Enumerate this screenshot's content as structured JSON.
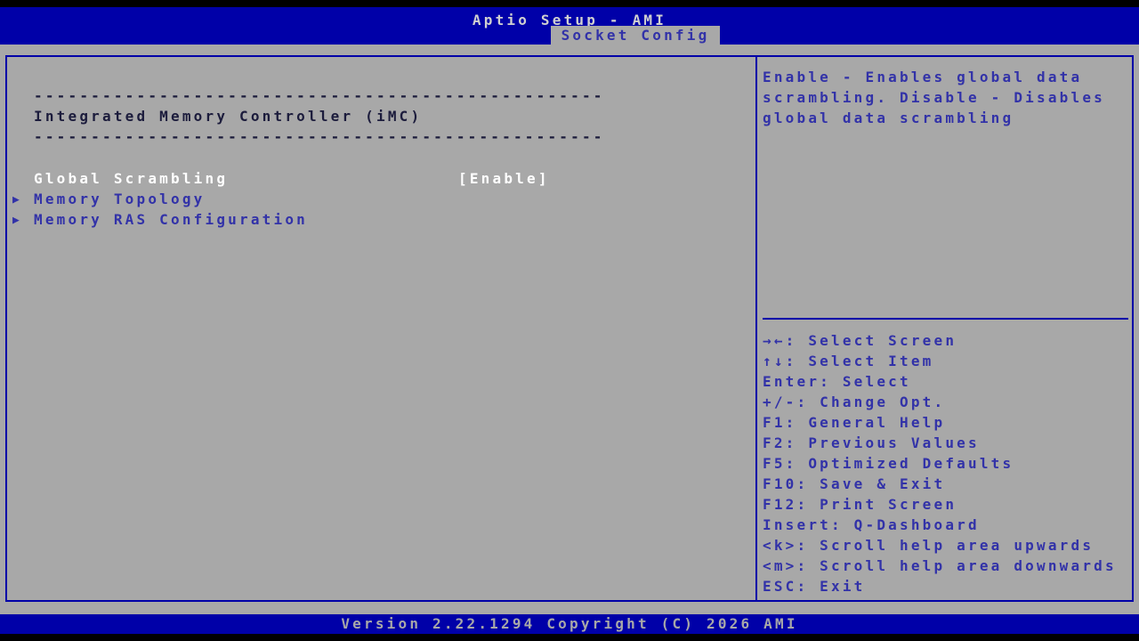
{
  "header": {
    "title": "Aptio Setup - AMI",
    "tab": "Socket Config"
  },
  "main": {
    "separator": "--------------------------------------------------",
    "section_title": "Integrated Memory Controller (iMC)",
    "submenu_marker": "▶",
    "items": [
      {
        "label": "Global Scrambling",
        "value": "[Enable]",
        "selected": true
      },
      {
        "label": "Memory Topology",
        "submenu": true
      },
      {
        "label": "Memory RAS Configuration",
        "submenu": true
      }
    ]
  },
  "help": {
    "text": "Enable - Enables global data scrambling. Disable - Disables global data scrambling"
  },
  "legend": {
    "lines": [
      "→←: Select Screen",
      "↑↓: Select Item",
      "Enter: Select",
      "+/-: Change Opt.",
      "F1: General Help",
      "F2: Previous Values",
      "F5: Optimized Defaults",
      "F10: Save & Exit",
      "F12: Print Screen",
      "Insert: Q-Dashboard",
      "<k>: Scroll help area upwards",
      "<m>: Scroll help area downwards",
      "ESC: Exit"
    ]
  },
  "footer": {
    "version_text": "Version 2.22.1294 Copyright (C) 2026 AMI"
  },
  "colors": {
    "band_blue": "#0000a8",
    "body_grey": "#a8a8a8",
    "text_blue": "#3232a8",
    "info_text_dark": "#1c1c3c",
    "selected_text": "#ffffff",
    "header_title_grey": "#d0d0d0",
    "black_strip": "#000000"
  }
}
